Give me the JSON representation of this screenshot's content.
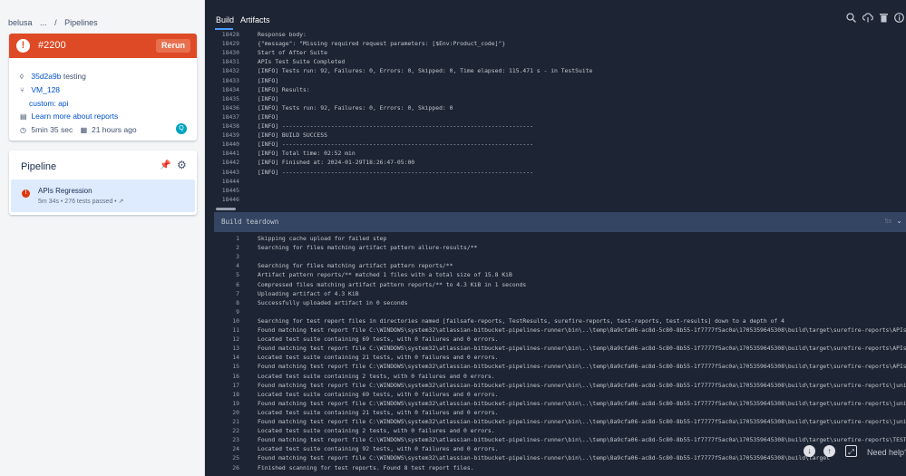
{
  "breadcrumb": [
    "belusa",
    "...",
    "/",
    "Pipelines"
  ],
  "build": {
    "number": "#2200",
    "rerun_label": "Rerun",
    "commit": "35d2a9b",
    "commit_msg": "testing",
    "branch": "VM_128",
    "custom": "custom: api",
    "reports_link": "Learn more about reports",
    "duration": "5min 35 sec",
    "time_ago": "21 hours ago",
    "avatar_letter": "Q"
  },
  "pipeline": {
    "title": "Pipeline",
    "step_name": "APIs Regression",
    "step_sub": "5m 34s • 276 tests passed • ↗"
  },
  "tabs": {
    "build": "Build",
    "artifacts": "Artifacts"
  },
  "log_top": [
    {
      "n": "18428",
      "t": "Response body:"
    },
    {
      "n": "18429",
      "t": "{\"message\": \"Missing required request parameters: [$Env:Product_code]\"}"
    },
    {
      "n": "18430",
      "t": "Start of After Suite"
    },
    {
      "n": "18431",
      "t": "APIs Test Suite Completed"
    },
    {
      "n": "18432",
      "t": "[INFO] Tests run: 92, Failures: 0, Errors: 0, Skipped: 0, Time elapsed: 115.471 s - in TestSuite"
    },
    {
      "n": "18433",
      "t": "[INFO]"
    },
    {
      "n": "18434",
      "t": "[INFO] Results:"
    },
    {
      "n": "18435",
      "t": "[INFO]"
    },
    {
      "n": "18436",
      "t": "[INFO] Tests run: 92, Failures: 0, Errors: 0, Skipped: 0"
    },
    {
      "n": "18437",
      "t": "[INFO]"
    },
    {
      "n": "18438",
      "t": "[INFO] ------------------------------------------------------------------------"
    },
    {
      "n": "18439",
      "t": "[INFO] BUILD SUCCESS"
    },
    {
      "n": "18440",
      "t": "[INFO] ------------------------------------------------------------------------"
    },
    {
      "n": "18441",
      "t": "[INFO] Total time:  02:52 min"
    },
    {
      "n": "18442",
      "t": "[INFO] Finished at: 2024-01-29T18:26:47-05:00"
    },
    {
      "n": "18443",
      "t": "[INFO] ------------------------------------------------------------------------"
    },
    {
      "n": "18444",
      "t": ""
    },
    {
      "n": "18445",
      "t": ""
    },
    {
      "n": "18446",
      "t": ""
    }
  ],
  "teardown": {
    "label": "Build teardown",
    "duration": "5s"
  },
  "log_bottom": [
    {
      "n": "1",
      "t": "Skipping cache upload for failed step"
    },
    {
      "n": "2",
      "t": "Searching for files matching artifact pattern allure-results/**"
    },
    {
      "n": "3",
      "t": ""
    },
    {
      "n": "4",
      "t": "Searching for files matching artifact pattern reports/**"
    },
    {
      "n": "5",
      "t": "Artifact pattern reports/** matched 1 files with a total size of 15.8 KiB"
    },
    {
      "n": "6",
      "t": "Compressed files matching artifact pattern reports/** to 4.3 KiB in 1 seconds"
    },
    {
      "n": "7",
      "t": "Uploading artifact of 4.3 KiB"
    },
    {
      "n": "8",
      "t": "Successfully uploaded artifact in 0 seconds"
    },
    {
      "n": "9",
      "t": ""
    },
    {
      "n": "10",
      "t": "Searching for test report files in directories named [failsafe-reports, TestResults, surefire-reports, test-reports, test-results] down to a depth of 4"
    },
    {
      "n": "11",
      "t": "Found matching test report file C:\\WINDOWS\\system32\\atlassian-bitbucket-pipelines-runner\\bin\\..\\temp\\8a9cfa06-ac8d-5c80-8b55-1f7777f5ac0a\\1705359645308\\build\\target\\surefire-reports\\APIs Test Suite"
    },
    {
      "n": "12",
      "t": "Located test suite containing 69 tests, with 0 failures and 0 errors."
    },
    {
      "n": "13",
      "t": "Found matching test report file C:\\WINDOWS\\system32\\atlassian-bitbucket-pipelines-runner\\bin\\..\\temp\\8a9cfa06-ac8d-5c80-8b55-1f7777f5ac0a\\1705359645308\\build\\target\\surefire-reports\\APIs Test Suite"
    },
    {
      "n": "14",
      "t": "Located test suite containing 21 tests, with 0 failures and 0 errors."
    },
    {
      "n": "15",
      "t": "Found matching test report file C:\\WINDOWS\\system32\\atlassian-bitbucket-pipelines-runner\\bin\\..\\temp\\8a9cfa06-ac8d-5c80-8b55-1f7777f5ac0a\\1705359645308\\build\\target\\surefire-reports\\APIs Test Suite"
    },
    {
      "n": "16",
      "t": "Located test suite containing 2 tests, with 0 failures and 0 errors."
    },
    {
      "n": "17",
      "t": "Found matching test report file C:\\WINDOWS\\system32\\atlassian-bitbucket-pipelines-runner\\bin\\..\\temp\\8a9cfa06-ac8d-5c80-8b55-1f7777f5ac0a\\1705359645308\\build\\target\\surefire-reports\\junitreports"
    },
    {
      "n": "18",
      "t": "Located test suite containing 69 tests, with 0 failures and 0 errors."
    },
    {
      "n": "19",
      "t": "Found matching test report file C:\\WINDOWS\\system32\\atlassian-bitbucket-pipelines-runner\\bin\\..\\temp\\8a9cfa06-ac8d-5c80-8b55-1f7777f5ac0a\\1705359645308\\build\\target\\surefire-reports\\junitreports"
    },
    {
      "n": "20",
      "t": "Located test suite containing 21 tests, with 0 failures and 0 errors."
    },
    {
      "n": "21",
      "t": "Found matching test report file C:\\WINDOWS\\system32\\atlassian-bitbucket-pipelines-runner\\bin\\..\\temp\\8a9cfa06-ac8d-5c80-8b55-1f7777f5ac0a\\1705359645308\\build\\target\\surefire-reports\\junitreports"
    },
    {
      "n": "22",
      "t": "Located test suite containing 2 tests, with 0 failures and 0 errors."
    },
    {
      "n": "23",
      "t": "Found matching test report file C:\\WINDOWS\\system32\\atlassian-bitbucket-pipelines-runner\\bin\\..\\temp\\8a9cfa06-ac8d-5c80-8b55-1f7777f5ac0a\\1705359645308\\build\\target\\surefire-reports\\TEST-TestSuite"
    },
    {
      "n": "24",
      "t": "Located test suite containing 92 tests, with 0 failures and 0 errors."
    },
    {
      "n": "25",
      "t": "Found matching test report file C:\\WINDOWS\\system32\\atlassian-bitbucket-pipelines-runner\\bin\\..\\temp\\8a9cfa06-ac8d-5c80-8b55-1f7777f5ac0a\\1705359645308\\build\\target"
    },
    {
      "n": "26",
      "t": "Finished scanning for test reports. Found 8 test report files."
    }
  ],
  "help_label": "Need help?",
  "icons": {
    "search": "search-icon",
    "upload": "cloud-upload-icon",
    "delete": "trash-icon",
    "info": "info-icon",
    "download": "download-icon",
    "scroll_up": "arrow-up-icon",
    "expand": "expand-icon"
  }
}
